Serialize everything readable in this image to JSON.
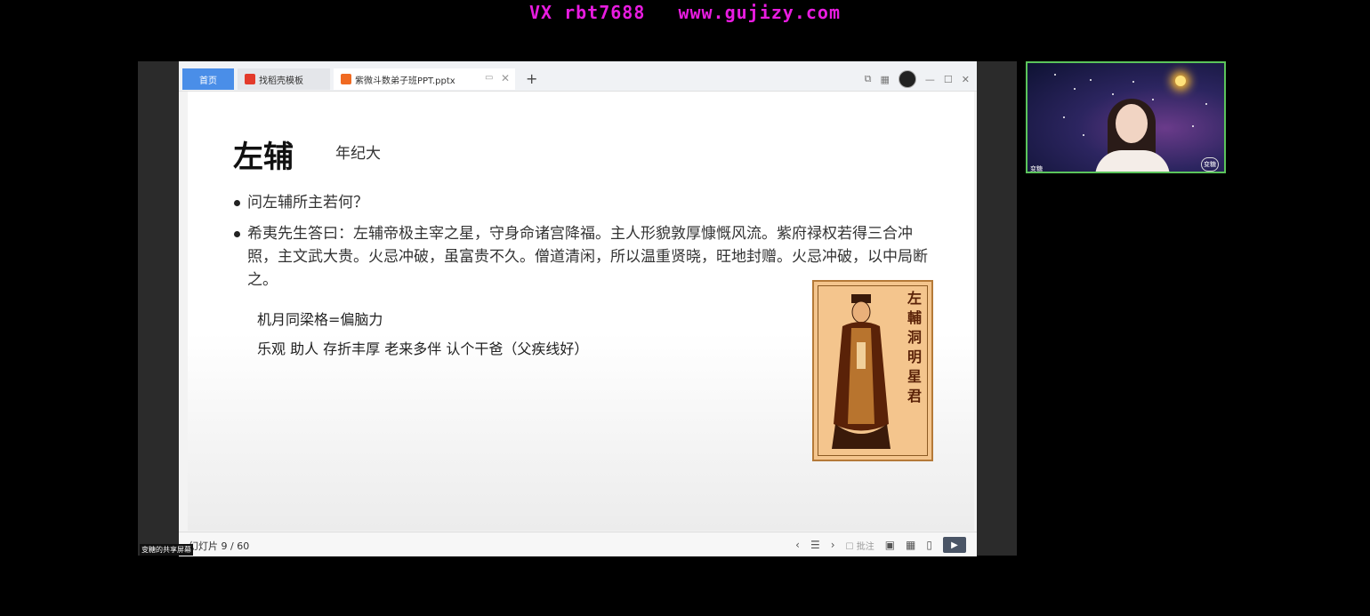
{
  "watermark": {
    "left": "VX  rbt7688",
    "right": "www.gujizy.com"
  },
  "share_label": "变糖的共享屏幕",
  "tabs": {
    "home": "首页",
    "template": "找稻壳模板",
    "document": "紫微斗数弟子班PPT.pptx"
  },
  "slide": {
    "title": "左辅",
    "subtitle": "年纪大",
    "bullets": [
      "问左辅所主若何？",
      "希夷先生答曰：左辅帝极主宰之星，守身命诸宫降福。主人形貌敦厚慷慨风流。紫府禄权若得三合冲照，主文武大贵。火忌冲破，虽富贵不久。僧道清闲，所以温重贤晓，旺地封赠。火忌冲破，以中局断之。"
    ],
    "notes": [
      "机月同梁格=偏脑力",
      "乐观  助人  存折丰厚  老来多伴  认个干爸（父疾线好）"
    ],
    "portrait_caption": "左輔洞明星君"
  },
  "statusbar": {
    "slide_counter": "幻灯片 9 / 60",
    "comment_label": "批注"
  },
  "webcam": {
    "name": "变糖",
    "badge": "变糖"
  },
  "colors": {
    "watermark": "#e81ce0",
    "home_tab": "#4a8ee8",
    "webcam_border": "#5bc45b",
    "play_button": "#4a5566"
  }
}
